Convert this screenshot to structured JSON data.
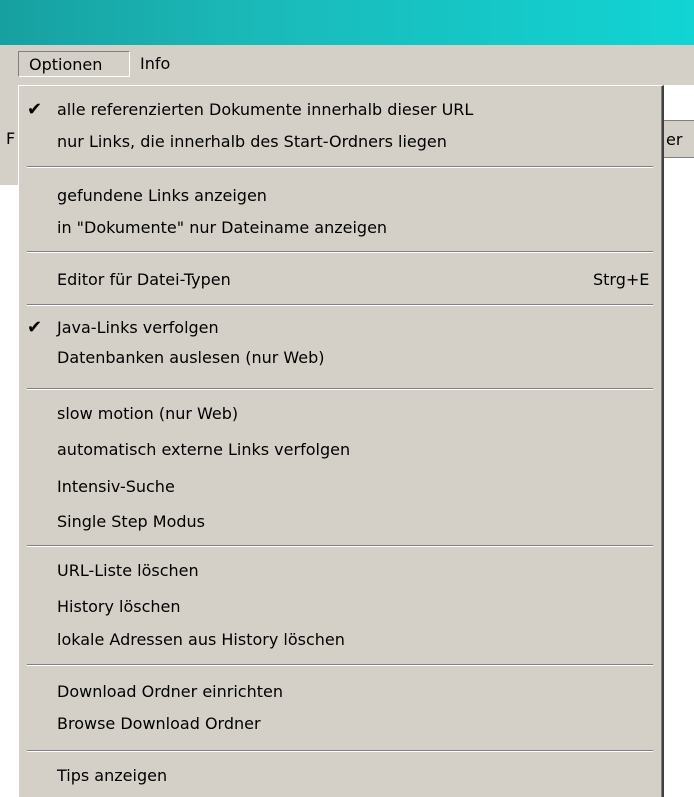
{
  "menubar": {
    "menus": [
      "Optionen",
      "Info"
    ]
  },
  "background": {
    "left_glyph": "F",
    "right_glyph": "er"
  },
  "dropdown": {
    "items": [
      {
        "label": "alle referenzierten Dokumente innerhalb dieser URL",
        "checked": true,
        "shortcut": ""
      },
      {
        "label": "nur Links, die innerhalb des Start-Ordners liegen",
        "checked": false,
        "shortcut": ""
      },
      {
        "label": "gefundene Links anzeigen",
        "checked": false,
        "shortcut": ""
      },
      {
        "label": "in \"Dokumente\" nur Dateiname anzeigen",
        "checked": false,
        "shortcut": ""
      },
      {
        "label": "Editor für Datei-Typen",
        "checked": false,
        "shortcut": "Strg+E"
      },
      {
        "label": "Java-Links verfolgen",
        "checked": true,
        "shortcut": ""
      },
      {
        "label": "Datenbanken auslesen (nur Web)",
        "checked": false,
        "shortcut": ""
      },
      {
        "label": "slow motion (nur Web)",
        "checked": false,
        "shortcut": ""
      },
      {
        "label": "automatisch externe Links verfolgen",
        "checked": false,
        "shortcut": ""
      },
      {
        "label": "Intensiv-Suche",
        "checked": false,
        "shortcut": ""
      },
      {
        "label": "Single Step Modus",
        "checked": false,
        "shortcut": ""
      },
      {
        "label": "URL-Liste löschen",
        "checked": false,
        "shortcut": ""
      },
      {
        "label": "History löschen",
        "checked": false,
        "shortcut": ""
      },
      {
        "label": "lokale Adressen aus History löschen",
        "checked": false,
        "shortcut": ""
      },
      {
        "label": "Download Ordner einrichten",
        "checked": false,
        "shortcut": ""
      },
      {
        "label": "Browse Download Ordner",
        "checked": false,
        "shortcut": ""
      },
      {
        "label": "Tips anzeigen",
        "checked": false,
        "shortcut": ""
      }
    ],
    "check_glyph": "✔"
  }
}
